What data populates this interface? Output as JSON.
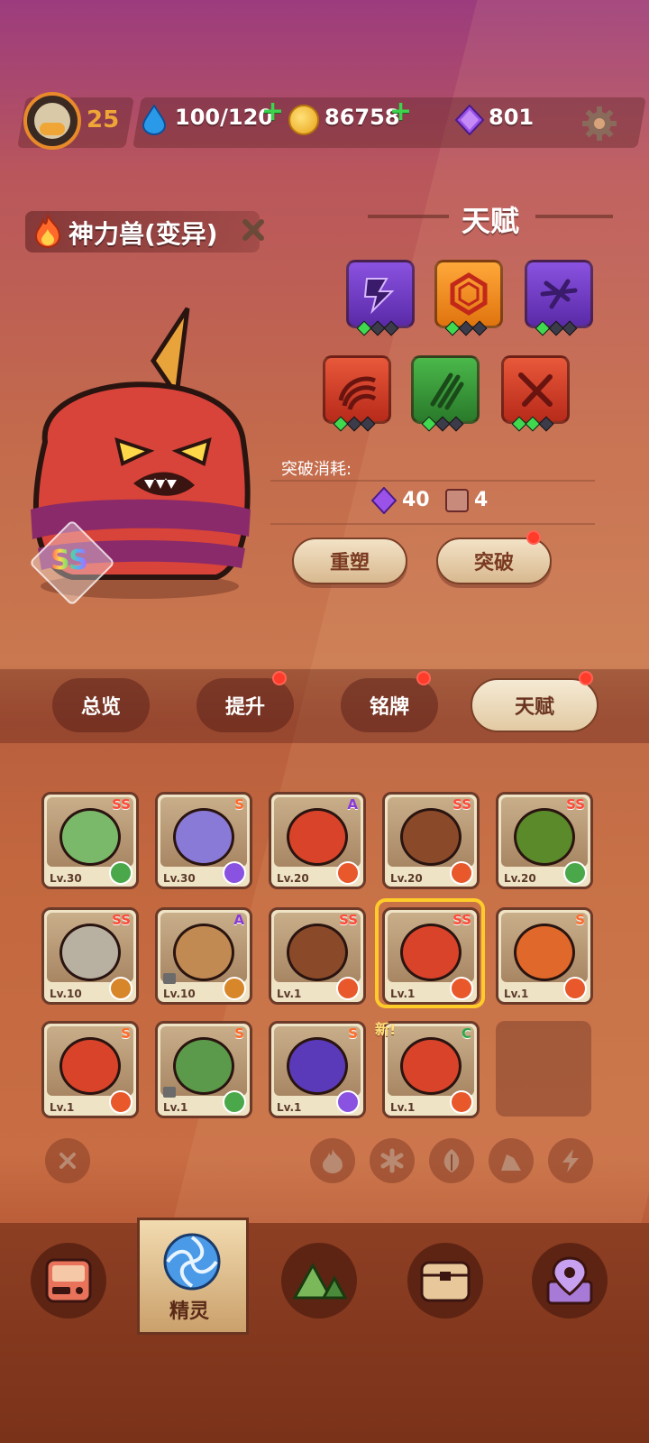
{
  "topbar": {
    "level": "25",
    "stamina": "100/120",
    "coins": "86758",
    "gems": "801",
    "icons": [
      "avatar",
      "water-drop-icon",
      "paw-coin-icon",
      "purple-gem-icon",
      "gear-icon"
    ]
  },
  "pet": {
    "name": "神力兽(变异)",
    "rank": "SS",
    "element": "fire"
  },
  "talent": {
    "title": "天赋",
    "skills": [
      {
        "icon": "lightning-icon",
        "color": "#7a3fc4",
        "level": 1
      },
      {
        "icon": "hexagon-icon",
        "color": "#e07a12",
        "level": 1
      },
      {
        "icon": "slash-icon",
        "color": "#7a3fc4",
        "level": 1
      },
      {
        "icon": "claw-icon",
        "color": "#d8432a",
        "level": 1
      },
      {
        "icon": "scratch-icon",
        "color": "#3c9a3c",
        "level": 1
      },
      {
        "icon": "cross-slash-icon",
        "color": "#d8432a",
        "level": 2
      }
    ],
    "cost_label": "突破消耗:",
    "cost_gem": "40",
    "cost_item": "4",
    "reshape_label": "重塑",
    "break_label": "突破"
  },
  "tabs": [
    {
      "label": "总览",
      "dot": false
    },
    {
      "label": "提升",
      "dot": true
    },
    {
      "label": "铭牌",
      "dot": true
    },
    {
      "label": "天赋",
      "dot": true,
      "active": true
    }
  ],
  "pets": [
    {
      "rank": "SS",
      "lv": "Lv.30",
      "element": "grass",
      "color": "#7ab86a"
    },
    {
      "rank": "S",
      "lv": "Lv.30",
      "element": "electric",
      "color": "#8a7ad8"
    },
    {
      "rank": "A",
      "lv": "Lv.20",
      "element": "fire",
      "color": "#d8432a"
    },
    {
      "rank": "SS",
      "lv": "Lv.20",
      "element": "fire",
      "color": "#8a4a2a"
    },
    {
      "rank": "SS",
      "lv": "Lv.20",
      "element": "grass",
      "color": "#5a8a2a"
    },
    {
      "rank": "SS",
      "lv": "Lv.10",
      "element": "earth",
      "color": "#b8b0a0"
    },
    {
      "rank": "A",
      "lv": "Lv.10",
      "element": "earth",
      "color": "#c08a52",
      "locked": true
    },
    {
      "rank": "SS",
      "lv": "Lv.1",
      "element": "fire",
      "color": "#8a4a2a"
    },
    {
      "rank": "SS",
      "lv": "Lv.1",
      "element": "fire",
      "color": "#d8432a",
      "selected": true
    },
    {
      "rank": "S",
      "lv": "Lv.1",
      "element": "fire",
      "color": "#e0682a"
    },
    {
      "rank": "S",
      "lv": "Lv.1",
      "element": "fire",
      "color": "#d8432a"
    },
    {
      "rank": "S",
      "lv": "Lv.1",
      "element": "grass",
      "color": "#5a9a4a",
      "locked": true
    },
    {
      "rank": "S",
      "lv": "Lv.1",
      "element": "electric",
      "color": "#5a3ab8"
    },
    {
      "rank": "C",
      "lv": "Lv.1",
      "element": "fire",
      "color": "#d8432a"
    }
  ],
  "new_label": "新!",
  "filters": [
    "close-icon",
    "fire-icon",
    "snowflake-icon",
    "leaf-icon",
    "rock-icon",
    "lightning-icon"
  ],
  "nav": {
    "items": [
      "console-icon",
      "spirit-icon",
      "mountain-icon",
      "chest-icon",
      "map-pin-icon"
    ],
    "active_label": "精灵"
  },
  "colors": {
    "fire": "#e8582a",
    "grass": "#4aa84a",
    "electric": "#8a52e0",
    "earth": "#d8862a",
    "rank_ss": "#ff4a3a",
    "rank_s": "#ff6a2a",
    "rank_a": "#8a3ad8",
    "rank_c": "#2aa84a"
  }
}
